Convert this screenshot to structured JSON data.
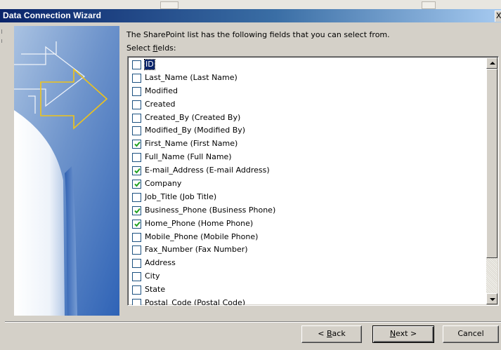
{
  "window": {
    "title": "Data Connection Wizard",
    "close_glyph": "X"
  },
  "intro_text": "The SharePoint list has the following fields that you can select from.",
  "select_label": {
    "prefix": "Select ",
    "mnemonic": "f",
    "suffix": "ields:"
  },
  "fields": [
    {
      "label": "ID",
      "checked": false
    },
    {
      "label": "Last_Name (Last Name)",
      "checked": false
    },
    {
      "label": "Modified",
      "checked": false
    },
    {
      "label": "Created",
      "checked": false
    },
    {
      "label": "Created_By (Created By)",
      "checked": false
    },
    {
      "label": "Modified_By (Modified By)",
      "checked": false
    },
    {
      "label": "First_Name (First Name)",
      "checked": true
    },
    {
      "label": "Full_Name (Full Name)",
      "checked": false
    },
    {
      "label": "E-mail_Address (E-mail Address)",
      "checked": true
    },
    {
      "label": "Company",
      "checked": true
    },
    {
      "label": "Job_Title (Job Title)",
      "checked": false
    },
    {
      "label": "Business_Phone (Business Phone)",
      "checked": true
    },
    {
      "label": "Home_Phone (Home Phone)",
      "checked": true
    },
    {
      "label": "Mobile_Phone (Mobile Phone)",
      "checked": false
    },
    {
      "label": "Fax_Number (Fax Number)",
      "checked": false
    },
    {
      "label": "Address",
      "checked": false
    },
    {
      "label": "City",
      "checked": false
    },
    {
      "label": "State",
      "checked": false
    },
    {
      "label": "Postal_Code (Postal Code)",
      "checked": false
    }
  ],
  "focused_field_index": 0,
  "buttons": {
    "back": {
      "prefix": "< ",
      "mnemonic": "B",
      "suffix": "ack"
    },
    "next": {
      "prefix": "",
      "mnemonic": "N",
      "suffix": "ext >"
    },
    "cancel": "Cancel"
  },
  "colors": {
    "title_bar_start": "#0a246a",
    "title_bar_end": "#a6caf0",
    "checkbox_border": "#1c5180",
    "check_mark": "#21a121",
    "dialog_face": "#d4d0c8"
  },
  "icons": {
    "panel_graphic": "wizard-arrow-graphic",
    "scroll_up": "scroll-up-arrow",
    "scroll_down": "scroll-down-arrow"
  }
}
